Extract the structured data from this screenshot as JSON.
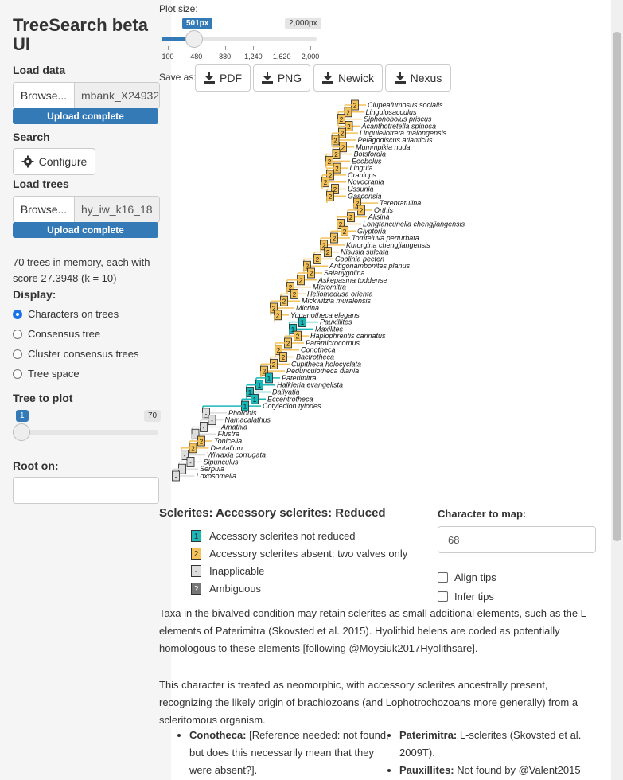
{
  "sidebar": {
    "title": "TreeSearch beta UI",
    "load_data": {
      "label": "Load data",
      "browse": "Browse...",
      "file_name": "mbank_X24932",
      "status": "Upload complete"
    },
    "search": {
      "label": "Search",
      "configure": "Configure"
    },
    "load_trees": {
      "label": "Load trees",
      "browse": "Browse...",
      "file_name": "hy_iw_k16_18",
      "status": "Upload complete"
    },
    "memory_text": "70 trees in memory, each with score 27.3948 (k = 10)",
    "display": {
      "label": "Display:",
      "options": [
        "Characters on trees",
        "Consensus tree",
        "Cluster consensus trees",
        "Tree space"
      ],
      "selected_index": 0
    },
    "tree_to_plot": {
      "label": "Tree to plot",
      "value": "1",
      "max": "70",
      "position_fraction": 0.0
    },
    "root_on": {
      "label": "Root on:",
      "value": ""
    }
  },
  "plot_size": {
    "label": "Plot size:",
    "value": "501px",
    "max_label": "2,000px",
    "value_fraction": 0.21,
    "ticks": [
      "100",
      "480",
      "880",
      "1,240",
      "1,620",
      "2,000"
    ]
  },
  "save": {
    "label": "Save as:",
    "buttons": [
      "PDF",
      "PNG",
      "Newick",
      "Nexus"
    ]
  },
  "colors": {
    "state1": "#1cb8b8",
    "state2": "#f4c25b",
    "inapplicable": "#dddddd",
    "ambiguous": "#777777",
    "accent": "#337ab7"
  },
  "tree": {
    "taxa": [
      "Clupeafumosus socialis",
      "Lingulosacculus",
      "Siphonobolus priscus",
      "Acanthotretella spinosa",
      "Lingulellotreta malongensis",
      "Pelagodiscus atlanticus",
      "Mummpikia nuda",
      "Botsfordia",
      "Eoobolus",
      "Lingula",
      "Craniops",
      "Novocrania",
      "Ussunia",
      "Gasconsia",
      "Terebratulina",
      "Orthis",
      "Alisina",
      "Longtancunella chengjiangensis",
      "Glyptoria",
      "Tomteluva perturbata",
      "Kutorgina chengjiangensis",
      "Nisusia sulcata",
      "Coolinia pecten",
      "Antigonambonites planus",
      "Salanygolina",
      "Askepasma toddense",
      "Micromitra",
      "Heliomedusa orienta",
      "Mickwitzia muralensis",
      "Micrina",
      "Yuganotheca elegans",
      "Pauxillites",
      "Maxilites",
      "Haplophrentis carinatus",
      "Paramicrocornus",
      "Conotheca",
      "Bactrotheca",
      "Cupitheca holocyclata",
      "Pedunculotheca diania",
      "Paterimitra",
      "Halkieria evangelista",
      "Dailyatia",
      "Eccentrotheca",
      "Cotyledion tylodes",
      "Phoronis",
      "Namacalathus",
      "Amathia",
      "Flustra",
      "Tonicella",
      "Dentalium",
      "Wiwaxia corrugata",
      "Sipunculus",
      "Serpula",
      "Loxosomella"
    ],
    "states": [
      "2",
      "2",
      "2",
      "2",
      "2",
      "2",
      "2",
      "2",
      "2",
      "2",
      "2",
      "2",
      "2",
      "2",
      "2",
      "2",
      "2",
      "2",
      "2",
      "2",
      "2",
      "2",
      "2",
      "2",
      "2",
      "2",
      "2",
      "2",
      "2",
      "2",
      "2",
      "1",
      "1",
      "2",
      "2",
      "2",
      "2",
      "2",
      "2",
      "1",
      "1",
      "1",
      "1",
      "1",
      "-",
      "-",
      "-",
      "-",
      "2",
      "2",
      "-",
      "-",
      "-",
      "-"
    ]
  },
  "character": {
    "title": "Sclerites: Accessory sclerites: Reduced",
    "legend": [
      {
        "symbol": "1",
        "label": "Accessory sclerites not reduced",
        "color": "#1cb8b8"
      },
      {
        "symbol": "2",
        "label": "Accessory sclerites absent: two valves only",
        "color": "#f4c25b"
      },
      {
        "symbol": "-",
        "label": "Inapplicable",
        "color": "#dddddd"
      },
      {
        "symbol": "?",
        "label": "Ambiguous",
        "color": "#777777"
      }
    ],
    "para1": "Taxa in the bivalved condition may retain sclerites as small additional elements, such as the L-elements of Paterimitra (Skovsted et al. 2015). Hyolithid helens are coded as potentially homologous to these elements [following @Moysiuk2017Hyolithsare].",
    "para2": "This character is treated as neomorphic, with accessory sclerites ancestrally present, recognizing the likely origin of brachiozoans (and Lophotrochozoans more generally) from a scleritomous organism.",
    "bullets_left": [
      {
        "name": "Conotheca:",
        "text": " [Reference needed: not found, but does this necessarily mean that they were absent?]."
      }
    ],
    "bullets_right": [
      {
        "name": "Paterimitra:",
        "text": " L-sclerites (Skovsted et al. 2009T)."
      },
      {
        "name": "Pauxillites:",
        "text": " Not found by @Valent2015"
      }
    ]
  },
  "character_to_map": {
    "label": "Character to map:",
    "value": "68",
    "align_tips": "Align tips",
    "infer_tips": "Infer tips"
  }
}
